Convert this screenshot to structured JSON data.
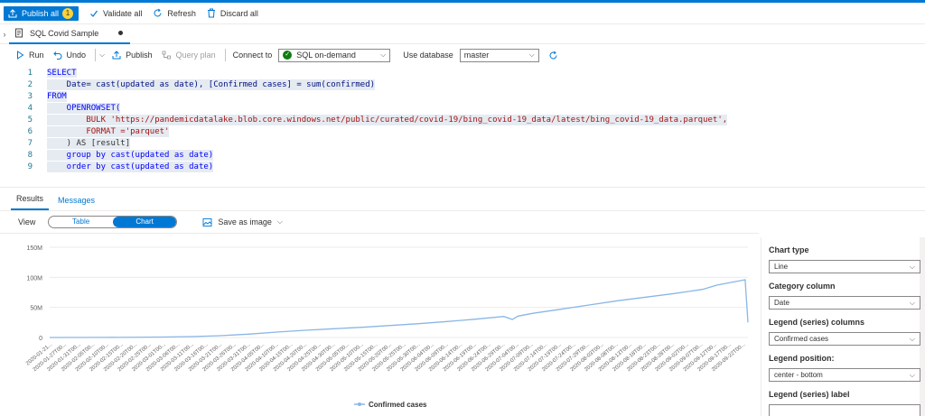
{
  "toolbar": {
    "publish_all_label": "Publish all",
    "publish_all_count": "1",
    "validate_all_label": "Validate all",
    "refresh_label": "Refresh",
    "discard_all_label": "Discard all"
  },
  "tab": {
    "title": "SQL Covid Sample"
  },
  "query_toolbar": {
    "run_label": "Run",
    "undo_label": "Undo",
    "publish_label": "Publish",
    "query_plan_label": "Query plan",
    "connect_to_label": "Connect to",
    "connect_to_value": "SQL on-demand",
    "use_database_label": "Use database",
    "use_database_value": "master"
  },
  "editor": {
    "line_numbers": [
      "1",
      "2",
      "3",
      "4",
      "5",
      "6",
      "7",
      "8",
      "9"
    ],
    "lines": [
      {
        "t": "SELECT"
      },
      {
        "t": "    Date= cast(updated as date), [Confirmed cases] = sum(confirmed)"
      },
      {
        "t": "FROM"
      },
      {
        "t": "    OPENROWSET("
      },
      {
        "t": "        BULK 'https://pandemicdatalake.blob.core.windows.net/public/curated/covid-19/bing_covid-19_data/latest/bing_covid-19_data.parquet',"
      },
      {
        "t": "        FORMAT ='parquet'"
      },
      {
        "t": "    ) AS [result]"
      },
      {
        "t": "    group by cast(updated as date)"
      },
      {
        "t": "    order by cast(updated as date)"
      }
    ]
  },
  "results": {
    "tab_results": "Results",
    "tab_messages": "Messages",
    "view_label": "View",
    "toggle_table": "Table",
    "toggle_chart": "Chart",
    "save_as_image": "Save as image"
  },
  "chart_data": {
    "type": "line",
    "y_ticks": [
      "150M",
      "100M",
      "50M",
      "0"
    ],
    "ylim": [
      0,
      150000000
    ],
    "x_tick_labels": [
      "2020-01-21...",
      "2020-01-27T00...",
      "2020-01-31T00...",
      "2020-02-05T00...",
      "2020-02-10T00...",
      "2020-02-15T00...",
      "2020-02-20T00...",
      "2020-02-25T00...",
      "2020-03-01T00...",
      "2020-03-06T00...",
      "2020-03-11T00...",
      "2020-03-16T00...",
      "2020-03-21T00...",
      "2020-03-26T00...",
      "2020-03-31T00...",
      "2020-04-05T00...",
      "2020-04-10T00...",
      "2020-04-15T00...",
      "2020-04-20T00...",
      "2020-04-25T00...",
      "2020-04-30T00...",
      "2020-05-05T00...",
      "2020-05-10T00...",
      "2020-05-15T00...",
      "2020-05-20T00...",
      "2020-05-25T00...",
      "2020-05-30T00...",
      "2020-06-04T00...",
      "2020-06-09T00...",
      "2020-06-14T00...",
      "2020-06-19T00...",
      "2020-06-24T00...",
      "2020-06-29T00...",
      "2020-07-04T00...",
      "2020-07-09T00...",
      "2020-07-14T00...",
      "2020-07-19T00...",
      "2020-07-24T00...",
      "2020-07-29T00...",
      "2020-08-03T00...",
      "2020-08-08T00...",
      "2020-08-13T00...",
      "2020-08-18T00...",
      "2020-08-23T00...",
      "2020-08-28T00...",
      "2020-09-02T00...",
      "2020-09-07T00...",
      "2020-09-12T00...",
      "2020-09-17T00...",
      "2020-09-22T00..."
    ],
    "series": [
      {
        "name": "Confirmed cases",
        "color": "#8ab6e6",
        "x": [
          "2020-01-21",
          "2020-02-10",
          "2020-03-01",
          "2020-03-11",
          "2020-03-21",
          "2020-03-31",
          "2020-04-10",
          "2020-04-20",
          "2020-04-30",
          "2020-05-10",
          "2020-05-20",
          "2020-05-30",
          "2020-06-09",
          "2020-06-19",
          "2020-06-29",
          "2020-07-02",
          "2020-07-04",
          "2020-07-09",
          "2020-07-19",
          "2020-07-29",
          "2020-08-08",
          "2020-08-18",
          "2020-08-28",
          "2020-09-07",
          "2020-09-12",
          "2020-09-22",
          "2020-09-23"
        ],
        "values": [
          0,
          100000,
          700000,
          1500000,
          3000000,
          5500000,
          9000000,
          12000000,
          14500000,
          17000000,
          20000000,
          23000000,
          26500000,
          30500000,
          35000000,
          30000000,
          35500000,
          40000000,
          47000000,
          54000000,
          61000000,
          67000000,
          73000000,
          80000000,
          87000000,
          96000000,
          25000000
        ]
      }
    ],
    "legend_position": "bottom-center"
  },
  "settings": {
    "chart_type_label": "Chart type",
    "chart_type_value": "Line",
    "category_column_label": "Category column",
    "category_column_value": "Date",
    "legend_columns_label": "Legend (series) columns",
    "legend_columns_value": "Confirmed cases",
    "legend_position_label": "Legend position:",
    "legend_position_value": "center - bottom",
    "legend_label_label": "Legend (series) label",
    "legend_label_value": ""
  }
}
